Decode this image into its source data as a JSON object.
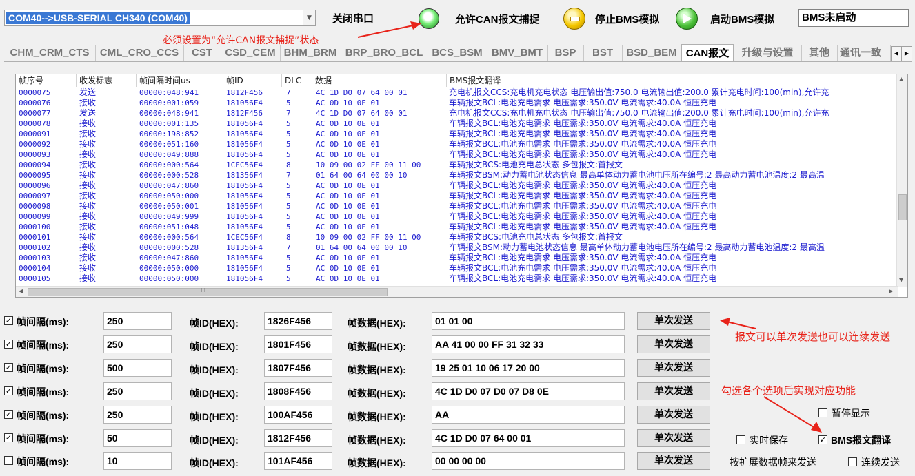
{
  "header": {
    "port_value": "COM40-->USB-SERIAL CH340 (COM40)",
    "close_port_label": "关闭串口",
    "capture_label": "允许CAN报文捕捉",
    "stop_label": "停止BMS模拟",
    "start_label": "启动BMS模拟",
    "bms_status": "BMS未启动",
    "annotation_capture": "必须设置为“允许CAN报文捕捉”状态"
  },
  "tabs": [
    "CHM_CRM_CTS",
    "CML_CRO_CCS",
    "CST",
    "CSD_CEM",
    "BHM_BRM",
    "BRP_BRO_BCL",
    "BCS_BSM",
    "BMV_BMT",
    "BSP",
    "BST",
    "BSD_BEM",
    "CAN报文",
    "升级与设置",
    "其他",
    "通讯一致性"
  ],
  "active_tab": "CAN报文",
  "table": {
    "columns": [
      "帧序号",
      "收发标志",
      "帧间隔时间us",
      "帧ID",
      "DLC",
      "数据",
      "BMS报文翻译"
    ],
    "rows": [
      [
        "0000075",
        "发送",
        "00000:048:941",
        "1812F456",
        "7",
        "4C 1D D0 07 64 00 01",
        "充电机报文CCS:充电机充电状态 电压输出值:750.0  电流输出值:200.0  累计充电时间:100(min),允许充"
      ],
      [
        "0000076",
        "接收",
        "00000:001:059",
        "181056F4",
        "5",
        "AC 0D 10 0E 01",
        "车辆报文BCL:电池充电需求 电压需求:350.0V  电流需求:40.0A  恒压充电"
      ],
      [
        "0000077",
        "发送",
        "00000:048:941",
        "1812F456",
        "7",
        "4C 1D D0 07 64 00 01",
        "充电机报文CCS:充电机充电状态 电压输出值:750.0  电流输出值:200.0  累计充电时间:100(min),允许充"
      ],
      [
        "0000078",
        "接收",
        "00000:001:135",
        "181056F4",
        "5",
        "AC 0D 10 0E 01",
        "车辆报文BCL:电池充电需求 电压需求:350.0V  电流需求:40.0A  恒压充电"
      ],
      [
        "0000091",
        "接收",
        "00000:198:852",
        "181056F4",
        "5",
        "AC 0D 10 0E 01",
        "车辆报文BCL:电池充电需求 电压需求:350.0V  电流需求:40.0A  恒压充电"
      ],
      [
        "0000092",
        "接收",
        "00000:051:160",
        "181056F4",
        "5",
        "AC 0D 10 0E 01",
        "车辆报文BCL:电池充电需求 电压需求:350.0V  电流需求:40.0A  恒压充电"
      ],
      [
        "0000093",
        "接收",
        "00000:049:888",
        "181056F4",
        "5",
        "AC 0D 10 0E 01",
        "车辆报文BCL:电池充电需求 电压需求:350.0V  电流需求:40.0A  恒压充电"
      ],
      [
        "0000094",
        "接收",
        "00000:000:564",
        "1CEC56F4",
        "8",
        "10 09 00 02 FF 00 11 00",
        "车辆报文BCS:电池充电总状态 多包报文:首报文"
      ],
      [
        "0000095",
        "接收",
        "00000:000:528",
        "181356F4",
        "7",
        "01 64 00 64 00 00 10",
        "车辆报文BSM:动力蓄电池状态信息 最高单体动力蓄电池电压所在编号:2  最高动力蓄电池温度:2  最高温"
      ],
      [
        "0000096",
        "接收",
        "00000:047:860",
        "181056F4",
        "5",
        "AC 0D 10 0E 01",
        "车辆报文BCL:电池充电需求 电压需求:350.0V  电流需求:40.0A  恒压充电"
      ],
      [
        "0000097",
        "接收",
        "00000:050:000",
        "181056F4",
        "5",
        "AC 0D 10 0E 01",
        "车辆报文BCL:电池充电需求 电压需求:350.0V  电流需求:40.0A  恒压充电"
      ],
      [
        "0000098",
        "接收",
        "00000:050:001",
        "181056F4",
        "5",
        "AC 0D 10 0E 01",
        "车辆报文BCL:电池充电需求 电压需求:350.0V  电流需求:40.0A  恒压充电"
      ],
      [
        "0000099",
        "接收",
        "00000:049:999",
        "181056F4",
        "5",
        "AC 0D 10 0E 01",
        "车辆报文BCL:电池充电需求 电压需求:350.0V  电流需求:40.0A  恒压充电"
      ],
      [
        "0000100",
        "接收",
        "00000:051:048",
        "181056F4",
        "5",
        "AC 0D 10 0E 01",
        "车辆报文BCL:电池充电需求 电压需求:350.0V  电流需求:40.0A  恒压充电"
      ],
      [
        "0000101",
        "接收",
        "00000:000:564",
        "1CEC56F4",
        "8",
        "10 09 00 02 FF 00 11 00",
        "车辆报文BCS:电池充电总状态 多包报文:首报文"
      ],
      [
        "0000102",
        "接收",
        "00000:000:528",
        "181356F4",
        "7",
        "01 64 00 64 00 00 10",
        "车辆报文BSM:动力蓄电池状态信息 最高单体动力蓄电池电压所在编号:2  最高动力蓄电池温度:2  最高温"
      ],
      [
        "0000103",
        "接收",
        "00000:047:860",
        "181056F4",
        "5",
        "AC 0D 10 0E 01",
        "车辆报文BCL:电池充电需求 电压需求:350.0V  电流需求:40.0A  恒压充电"
      ],
      [
        "0000104",
        "接收",
        "00000:050:000",
        "181056F4",
        "5",
        "AC 0D 10 0E 01",
        "车辆报文BCL:电池充电需求 电压需求:350.0V  电流需求:40.0A  恒压充电"
      ],
      [
        "0000105",
        "接收",
        "00000:050:000",
        "181056F4",
        "5",
        "AC 0D 10 0E 01",
        "车辆报文BCL:电池充电需求 电压需求:350.0V  电流需求:40.0A  恒压充电"
      ]
    ]
  },
  "send_form": {
    "interval_label": "帧间隔(ms):",
    "id_label": "帧ID(HEX):",
    "data_label": "帧数据(HEX):",
    "send_label": "单次发送",
    "rows": [
      {
        "checked": true,
        "interval": "250",
        "id": "1826F456",
        "data": "01 01 00"
      },
      {
        "checked": true,
        "interval": "250",
        "id": "1801F456",
        "data": "AA 41 00 00 FF 31 32 33"
      },
      {
        "checked": true,
        "interval": "500",
        "id": "1807F456",
        "data": "19 25 01 10 06 17 20 00"
      },
      {
        "checked": true,
        "interval": "250",
        "id": "1808F456",
        "data": "4C 1D D0 07 D0 07 D8 0E"
      },
      {
        "checked": true,
        "interval": "250",
        "id": "100AF456",
        "data": "AA"
      },
      {
        "checked": true,
        "interval": "50",
        "id": "1812F456",
        "data": "4C 1D D0 07 64 00 01"
      },
      {
        "checked": false,
        "interval": "10",
        "id": "101AF456",
        "data": "00 00 00 00"
      }
    ]
  },
  "options": {
    "pause_display": "暂停显示",
    "realtime_save": "实时保存",
    "bms_translate": "BMS报文翻译",
    "extended_frame": "按扩展数据帧来发送",
    "continuous_send": "连续发送"
  },
  "annotations": {
    "send_note": "报文可以单次发送也可以连续发送",
    "option_note": "勾选各个选项后实现对应功能"
  },
  "scroll_glyph": "III",
  "colors": {
    "accent_selection": "#3a78d4",
    "list_text": "#1c1ccf",
    "annotation": "#e8231a"
  }
}
